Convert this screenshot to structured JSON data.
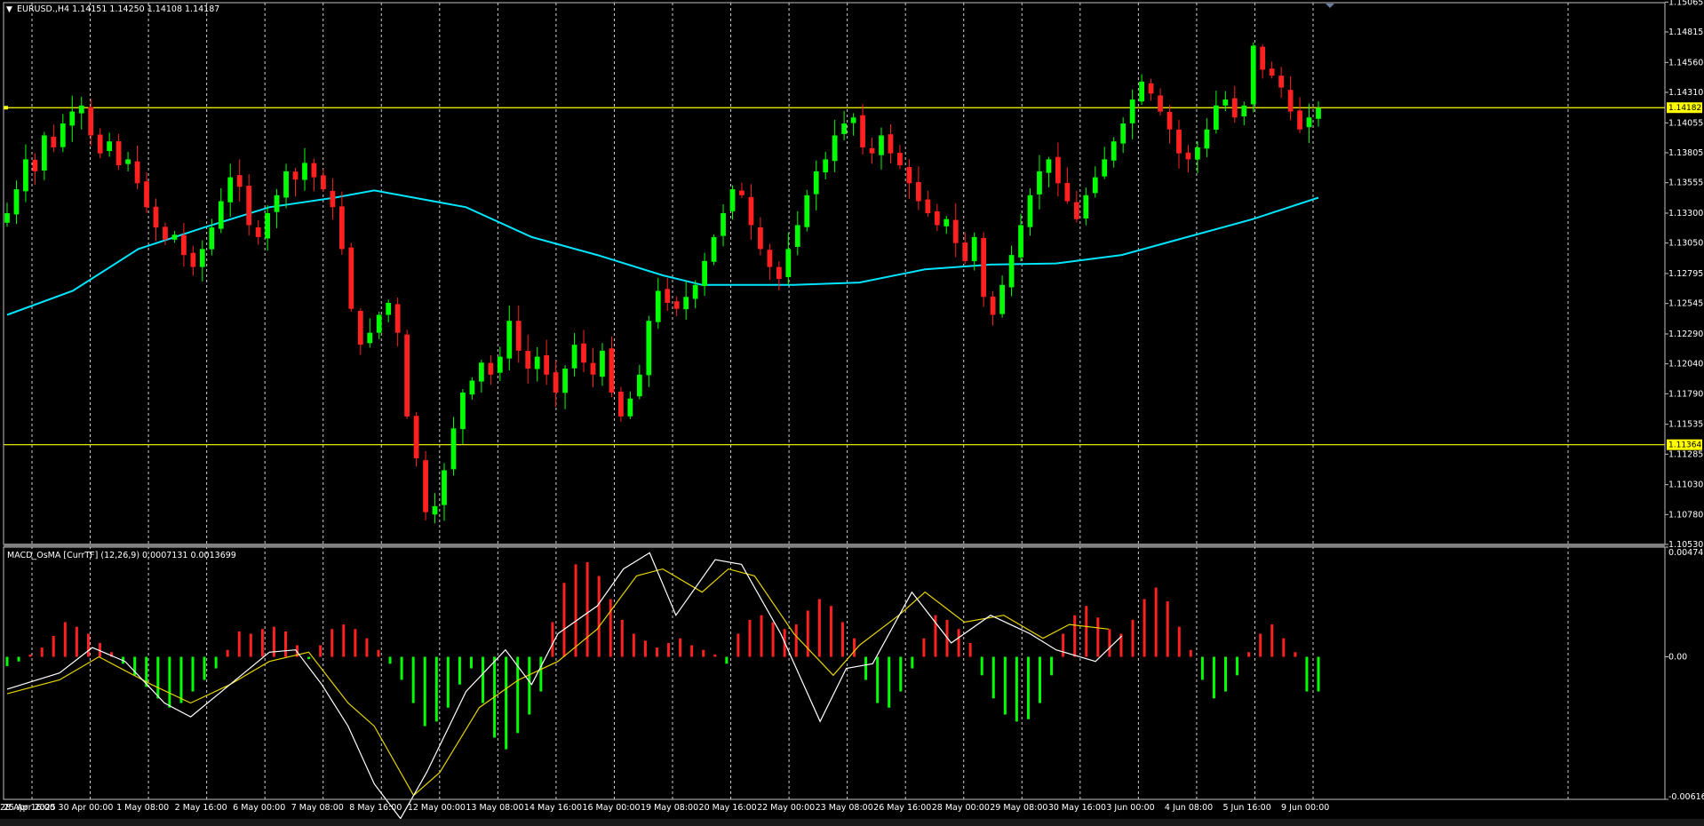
{
  "window": {
    "symbol_header": "EURUSD.,H4  1.14151 1.14250 1.14108 1.14187",
    "indicator_header": "MACD_OsMA [CurrTF] (12,26,9) 0.0007131 0.0013699"
  },
  "colors": {
    "background": "#000000",
    "frame": "#c0c0c0",
    "bull_candle": "#00ff00",
    "bear_candle": "#ff2020",
    "moving_average": "#00e5ff",
    "horizontal_line": "#ffff00",
    "hist_positive": "#ff2020",
    "hist_negative": "#00ff00",
    "macd_line": "#ffffff",
    "signal_line": "#e6d400",
    "vgrid": "#d0d0d0"
  },
  "chart_data": [
    {
      "type": "candlestick",
      "title": "EURUSD.,H4",
      "ohlc_header": "1.14151 1.14250 1.14108 1.14187",
      "ylim": [
        1.1053,
        1.1506
      ],
      "y_ticks": [
        "1.15065",
        "1.14815",
        "1.14560",
        "1.14310",
        "1.14055",
        "1.13805",
        "1.13555",
        "1.13300",
        "1.13050",
        "1.12795",
        "1.12545",
        "1.12290",
        "1.12040",
        "1.11790",
        "1.11535",
        "1.11285",
        "1.11030",
        "1.10780",
        "1.10530"
      ],
      "x_ticks": [
        "25 Apr 2025",
        "28 Apr 16:00",
        "30 Apr 00:00",
        "1 May 08:00",
        "2 May 16:00",
        "6 May 00:00",
        "7 May 08:00",
        "8 May 16:00",
        "12 May 00:00",
        "13 May 08:00",
        "14 May 16:00",
        "16 May 00:00",
        "19 May 08:00",
        "20 May 16:00",
        "22 May 00:00",
        "23 May 08:00",
        "26 May 16:00",
        "28 May 00:00",
        "29 May 08:00",
        "30 May 16:00",
        "3 Jun 00:00",
        "4 Jun 08:00",
        "5 Jun 16:00",
        "9 Jun 00:00"
      ],
      "close_anchors": [
        1.133,
        1.135,
        1.1375,
        1.1365,
        1.1395,
        1.1385,
        1.1405,
        1.1415,
        1.142,
        1.1395,
        1.138,
        1.139,
        1.137,
        1.1375,
        1.1355,
        1.1335,
        1.1318,
        1.1308,
        1.1312,
        1.1295,
        1.1285,
        1.13,
        1.1318,
        1.134,
        1.136,
        1.1352,
        1.132,
        1.131,
        1.133,
        1.1345,
        1.1365,
        1.1358,
        1.1372,
        1.136,
        1.135,
        1.1335,
        1.13,
        1.125,
        1.122,
        1.123,
        1.1245,
        1.1255,
        1.123,
        1.116,
        1.1125,
        1.108,
        1.1085,
        1.1115,
        1.115,
        1.118,
        1.119,
        1.1205,
        1.1195,
        1.121,
        1.124,
        1.1215,
        1.12,
        1.121,
        1.1195,
        1.118,
        1.12,
        1.122,
        1.1205,
        1.1195,
        1.1215,
        1.118,
        1.116,
        1.1175,
        1.1195,
        1.124,
        1.1265,
        1.1255,
        1.125,
        1.126,
        1.127,
        1.129,
        1.131,
        1.133,
        1.135,
        1.1345,
        1.132,
        1.13,
        1.1285,
        1.1275,
        1.13,
        1.132,
        1.1345,
        1.1365,
        1.1375,
        1.1395,
        1.1405,
        1.141,
        1.1385,
        1.138,
        1.1395,
        1.138,
        1.137,
        1.1355,
        1.134,
        1.133,
        1.132,
        1.1325,
        1.1305,
        1.129,
        1.131,
        1.126,
        1.1245,
        1.127,
        1.1295,
        1.132,
        1.1345,
        1.1365,
        1.1375,
        1.1355,
        1.134,
        1.1325,
        1.1345,
        1.136,
        1.1375,
        1.139,
        1.1405,
        1.1425,
        1.144,
        1.143,
        1.1415,
        1.14,
        1.138,
        1.1375,
        1.1385,
        1.14,
        1.142,
        1.1425,
        1.141,
        1.142,
        1.147,
        1.145,
        1.1445,
        1.1435,
        1.1415,
        1.14,
        1.141,
        1.1418
      ],
      "moving_average": [
        {
          "t": 0,
          "price": 1.1245
        },
        {
          "t": 0.05,
          "price": 1.1265
        },
        {
          "t": 0.1,
          "price": 1.13
        },
        {
          "t": 0.15,
          "price": 1.1318
        },
        {
          "t": 0.2,
          "price": 1.1335
        },
        {
          "t": 0.25,
          "price": 1.1343
        },
        {
          "t": 0.28,
          "price": 1.1349
        },
        {
          "t": 0.35,
          "price": 1.1335
        },
        {
          "t": 0.4,
          "price": 1.131
        },
        {
          "t": 0.45,
          "price": 1.1295
        },
        {
          "t": 0.5,
          "price": 1.1278
        },
        {
          "t": 0.53,
          "price": 1.127
        },
        {
          "t": 0.6,
          "price": 1.127
        },
        {
          "t": 0.65,
          "price": 1.1272
        },
        {
          "t": 0.7,
          "price": 1.1283
        },
        {
          "t": 0.75,
          "price": 1.1287
        },
        {
          "t": 0.8,
          "price": 1.1288
        },
        {
          "t": 0.85,
          "price": 1.1295
        },
        {
          "t": 0.9,
          "price": 1.131
        },
        {
          "t": 0.95,
          "price": 1.1325
        },
        {
          "t": 1.0,
          "price": 1.1343
        }
      ],
      "horizontal_lines": [
        {
          "price": 1.14182,
          "label": "1.14182"
        },
        {
          "price": 1.11364,
          "label": "1.11364"
        }
      ]
    },
    {
      "type": "macd",
      "title": "MACD_OsMA [CurrTF] (12,26,9)",
      "values_header": "0.0007131 0.0013699",
      "ylim": [
        -0.006169,
        0.004747
      ],
      "y_ticks": [
        "0.004747",
        "0.00",
        "-0.006169"
      ],
      "histogram": [
        -0.0004,
        -0.0002,
        0.0001,
        0.0004,
        0.0009,
        0.0015,
        0.0013,
        0.001,
        0.0006,
        0.0002,
        -0.0003,
        -0.0008,
        -0.0013,
        -0.0018,
        -0.0022,
        -0.002,
        -0.0015,
        -0.001,
        -0.0005,
        0.0003,
        0.0011,
        0.001,
        0.0012,
        0.0013,
        0.0011,
        0.0005,
        -0.0001,
        0.0005,
        0.0012,
        0.0014,
        0.0012,
        0.0008,
        0.0003,
        -0.0003,
        -0.001,
        -0.002,
        -0.003,
        -0.0028,
        -0.0022,
        -0.0012,
        -0.0005,
        -0.002,
        -0.0035,
        -0.004,
        -0.0033,
        -0.0025,
        -0.0015,
        0.0015,
        0.0032,
        0.004,
        0.0041,
        0.0035,
        0.0025,
        0.0016,
        0.001,
        0.0007,
        0.0004,
        0.0006,
        0.0008,
        0.0005,
        0.0003,
        0.0001,
        -0.0003,
        0.001,
        0.0016,
        0.0018,
        0.0015,
        0.0012,
        0.0014,
        0.002,
        0.0025,
        0.0022,
        0.0015,
        0.0008,
        -0.001,
        -0.002,
        -0.0022,
        -0.0015,
        -0.0005,
        0.0008,
        0.0018,
        0.0016,
        0.0012,
        0.0006,
        -0.0008,
        -0.0018,
        -0.0025,
        -0.0028,
        -0.0027,
        -0.002,
        -0.0008,
        0.001,
        0.0018,
        0.0022,
        0.0017,
        0.0012,
        0.001,
        0.0016,
        0.0025,
        0.003,
        0.0024,
        0.0013,
        0.0003,
        -0.001,
        -0.0018,
        -0.0015,
        -0.0008,
        0.0002,
        0.001,
        0.0014,
        0.0008,
        0.0002,
        -0.0015,
        -0.0015
      ],
      "macd_line": [
        {
          "t": 0,
          "v": -0.0014
        },
        {
          "t": 0.04,
          "v": -0.0007
        },
        {
          "t": 0.065,
          "v": 0.0004
        },
        {
          "t": 0.09,
          "v": -0.0002
        },
        {
          "t": 0.12,
          "v": -0.002
        },
        {
          "t": 0.14,
          "v": -0.0026
        },
        {
          "t": 0.17,
          "v": -0.0012
        },
        {
          "t": 0.2,
          "v": 0.0002
        },
        {
          "t": 0.22,
          "v": 0.0003
        },
        {
          "t": 0.24,
          "v": -0.0012
        },
        {
          "t": 0.26,
          "v": -0.003
        },
        {
          "t": 0.28,
          "v": -0.0055
        },
        {
          "t": 0.3,
          "v": -0.007
        },
        {
          "t": 0.32,
          "v": -0.005
        },
        {
          "t": 0.35,
          "v": -0.0015
        },
        {
          "t": 0.38,
          "v": 0.0003
        },
        {
          "t": 0.4,
          "v": -0.0012
        },
        {
          "t": 0.42,
          "v": 0.001
        },
        {
          "t": 0.45,
          "v": 0.0022
        },
        {
          "t": 0.47,
          "v": 0.0038
        },
        {
          "t": 0.49,
          "v": 0.0045
        },
        {
          "t": 0.51,
          "v": 0.0018
        },
        {
          "t": 0.54,
          "v": 0.0042
        },
        {
          "t": 0.56,
          "v": 0.004
        },
        {
          "t": 0.59,
          "v": 0.001
        },
        {
          "t": 0.62,
          "v": -0.0028
        },
        {
          "t": 0.64,
          "v": -0.0005
        },
        {
          "t": 0.66,
          "v": -0.0003
        },
        {
          "t": 0.69,
          "v": 0.0028
        },
        {
          "t": 0.72,
          "v": 0.0006
        },
        {
          "t": 0.75,
          "v": 0.0018
        },
        {
          "t": 0.78,
          "v": 0.001
        },
        {
          "t": 0.8,
          "v": 0.0003
        },
        {
          "t": 0.83,
          "v": -0.0002
        },
        {
          "t": 0.85,
          "v": 0.0009
        }
      ],
      "signal_line": [
        {
          "t": 0,
          "v": -0.0016
        },
        {
          "t": 0.04,
          "v": -0.001
        },
        {
          "t": 0.07,
          "v": 0.0
        },
        {
          "t": 0.11,
          "v": -0.0012
        },
        {
          "t": 0.14,
          "v": -0.002
        },
        {
          "t": 0.17,
          "v": -0.0012
        },
        {
          "t": 0.2,
          "v": -0.0002
        },
        {
          "t": 0.23,
          "v": 0.0002
        },
        {
          "t": 0.26,
          "v": -0.002
        },
        {
          "t": 0.28,
          "v": -0.003
        },
        {
          "t": 0.31,
          "v": -0.006
        },
        {
          "t": 0.33,
          "v": -0.005
        },
        {
          "t": 0.36,
          "v": -0.0022
        },
        {
          "t": 0.39,
          "v": -0.001
        },
        {
          "t": 0.42,
          "v": -0.0002
        },
        {
          "t": 0.45,
          "v": 0.0012
        },
        {
          "t": 0.48,
          "v": 0.0035
        },
        {
          "t": 0.5,
          "v": 0.0038
        },
        {
          "t": 0.53,
          "v": 0.0028
        },
        {
          "t": 0.55,
          "v": 0.0038
        },
        {
          "t": 0.57,
          "v": 0.0035
        },
        {
          "t": 0.6,
          "v": 0.001
        },
        {
          "t": 0.63,
          "v": -0.0008
        },
        {
          "t": 0.65,
          "v": 0.0005
        },
        {
          "t": 0.68,
          "v": 0.0018
        },
        {
          "t": 0.7,
          "v": 0.0028
        },
        {
          "t": 0.73,
          "v": 0.0015
        },
        {
          "t": 0.76,
          "v": 0.0018
        },
        {
          "t": 0.79,
          "v": 0.0008
        },
        {
          "t": 0.81,
          "v": 0.0014
        },
        {
          "t": 0.84,
          "v": 0.0012
        }
      ]
    }
  ]
}
